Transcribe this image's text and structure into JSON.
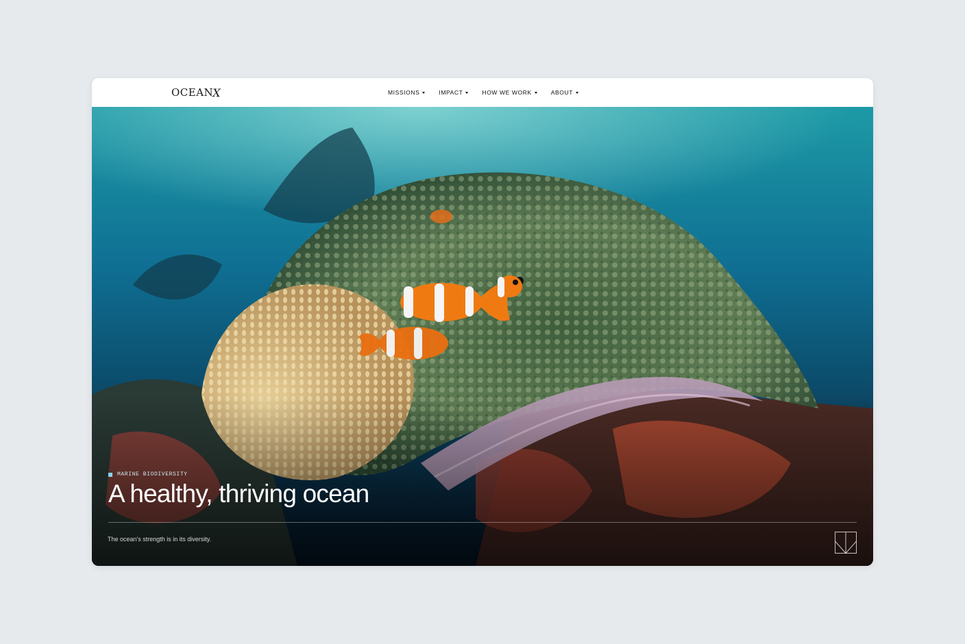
{
  "brand": {
    "logo_text": "OCEAN",
    "logo_mark": "X"
  },
  "nav": {
    "items": [
      {
        "label": "MISSIONS"
      },
      {
        "label": "IMPACT"
      },
      {
        "label": "HOW WE WORK"
      },
      {
        "label": "ABOUT"
      }
    ]
  },
  "hero": {
    "tag": "MARINE BIODIVERSITY",
    "title": "A healthy, thriving ocean",
    "subtitle": "The ocean's strength is in its diversity.",
    "scroll_icon": "scroll-down-icon"
  },
  "colors": {
    "page_bg": "#e6eaed",
    "nav_bg": "#ffffff",
    "water": "#0e6d8a",
    "accent": "#8ad1ee"
  }
}
